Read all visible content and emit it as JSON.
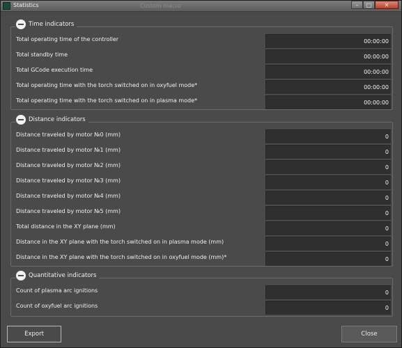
{
  "window": {
    "title": "Statistics",
    "background_title": "Custom macro"
  },
  "time_section": {
    "title": "Time indicators",
    "rows": [
      {
        "label": "Total operating time of the controller",
        "value": "00:00:00"
      },
      {
        "label": "Total standby time",
        "value": "00:00:00"
      },
      {
        "label": "Total GCode execution time",
        "value": "00:00:00"
      },
      {
        "label": "Total operating time with the torch switched on in oxyfuel mode*",
        "value": "00:00:00"
      },
      {
        "label": "Total operating time with the torch switched on in plasma mode*",
        "value": "00:00:00"
      }
    ]
  },
  "distance_section": {
    "title": "Distance indicators",
    "rows": [
      {
        "label": "Distance traveled by motor №0 (mm)",
        "value": "0"
      },
      {
        "label": "Distance traveled by motor №1 (mm)",
        "value": "0"
      },
      {
        "label": "Distance traveled by motor №2 (mm)",
        "value": "0"
      },
      {
        "label": "Distance traveled by motor №3 (mm)",
        "value": "0"
      },
      {
        "label": "Distance traveled by motor №4 (mm)",
        "value": "0"
      },
      {
        "label": "Distance traveled by motor №5 (mm)",
        "value": "0"
      },
      {
        "label": "Total distance in the XY plane (mm)",
        "value": "0"
      },
      {
        "label": "Distance in the XY plane with the torch switched on in plasma mode (mm)",
        "value": "0"
      },
      {
        "label": "Distance in the XY plane with the torch switched on in oxyfuel mode (mm)*",
        "value": "0"
      }
    ]
  },
  "quantity_section": {
    "title": "Quantitative indicators",
    "rows": [
      {
        "label": "Count of plasma arc ignitions",
        "value": "0"
      },
      {
        "label": "Count of oxyfuel arc ignitions",
        "value": "0"
      }
    ]
  },
  "footer": {
    "export_label": "Export",
    "close_label": "Close"
  },
  "title_buttons": {
    "minimize": "–",
    "maximize": "□",
    "close": "✕"
  }
}
